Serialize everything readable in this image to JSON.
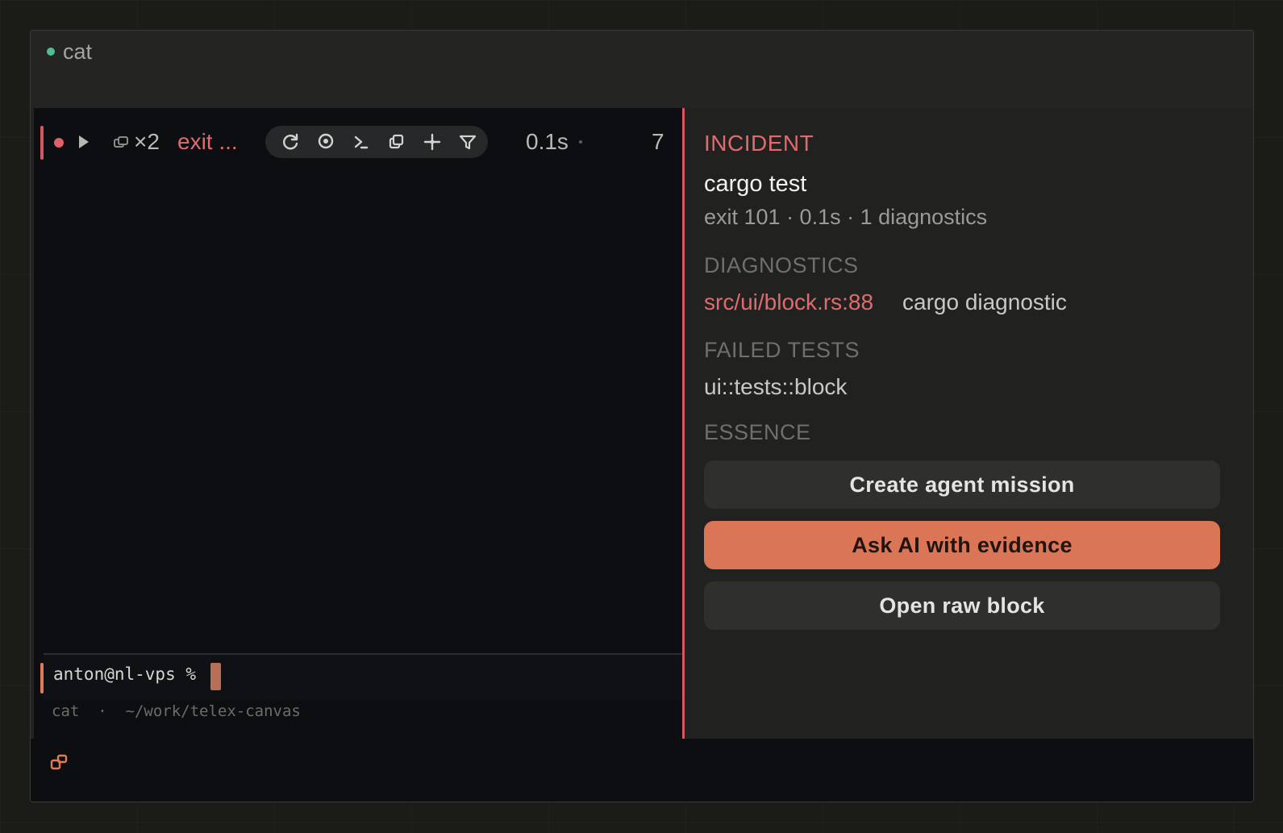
{
  "window": {
    "title": "cat"
  },
  "block": {
    "count": "×2",
    "exit_short": "exit ...",
    "duration": "0.1s",
    "line_count": "7",
    "toolbar": [
      "rerun-icon",
      "stop-icon",
      "terminal-icon",
      "copy-icon",
      "sparkle-icon",
      "filter-icon"
    ]
  },
  "prompt": {
    "text": "anton@nl-vps %",
    "cwd_line": "cat  ·  ~/work/telex-canvas"
  },
  "incident": {
    "label": "INCIDENT",
    "command": "cargo test",
    "summary": "exit 101 · 0.1s · 1 diagnostics",
    "diagnostics_heading": "DIAGNOSTICS",
    "diagnostic": {
      "location": "src/ui/block.rs:88",
      "message": "cargo diagnostic"
    },
    "failed_heading": "FAILED TESTS",
    "failed_tests": [
      "ui::tests::block"
    ],
    "essence_heading": "ESSENCE",
    "actions": {
      "create_mission": "Create agent mission",
      "ask_ai": "Ask AI with evidence",
      "open_raw": "Open raw block"
    }
  },
  "colors": {
    "error": "#e06a6e",
    "accent": "#da7556",
    "ok": "#4fc08d",
    "warn": "#e8a33a"
  }
}
